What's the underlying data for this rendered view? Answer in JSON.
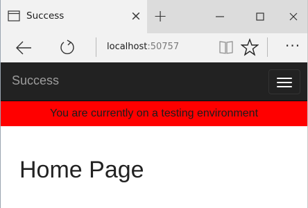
{
  "browser": {
    "tab": {
      "title": "Success",
      "close_glyph": "×"
    },
    "new_tab_glyph": "+",
    "window_controls": [
      "minimize-icon",
      "maximize-icon",
      "close-icon"
    ],
    "address": {
      "host": "localhost",
      "port": ":50757"
    },
    "more_glyph": "···"
  },
  "site": {
    "brand": "Success",
    "banner": "You are currently on a testing environment",
    "colors": {
      "navbar": "#222222",
      "banner": "#ff0000"
    }
  },
  "main": {
    "heading": "Home Page"
  }
}
